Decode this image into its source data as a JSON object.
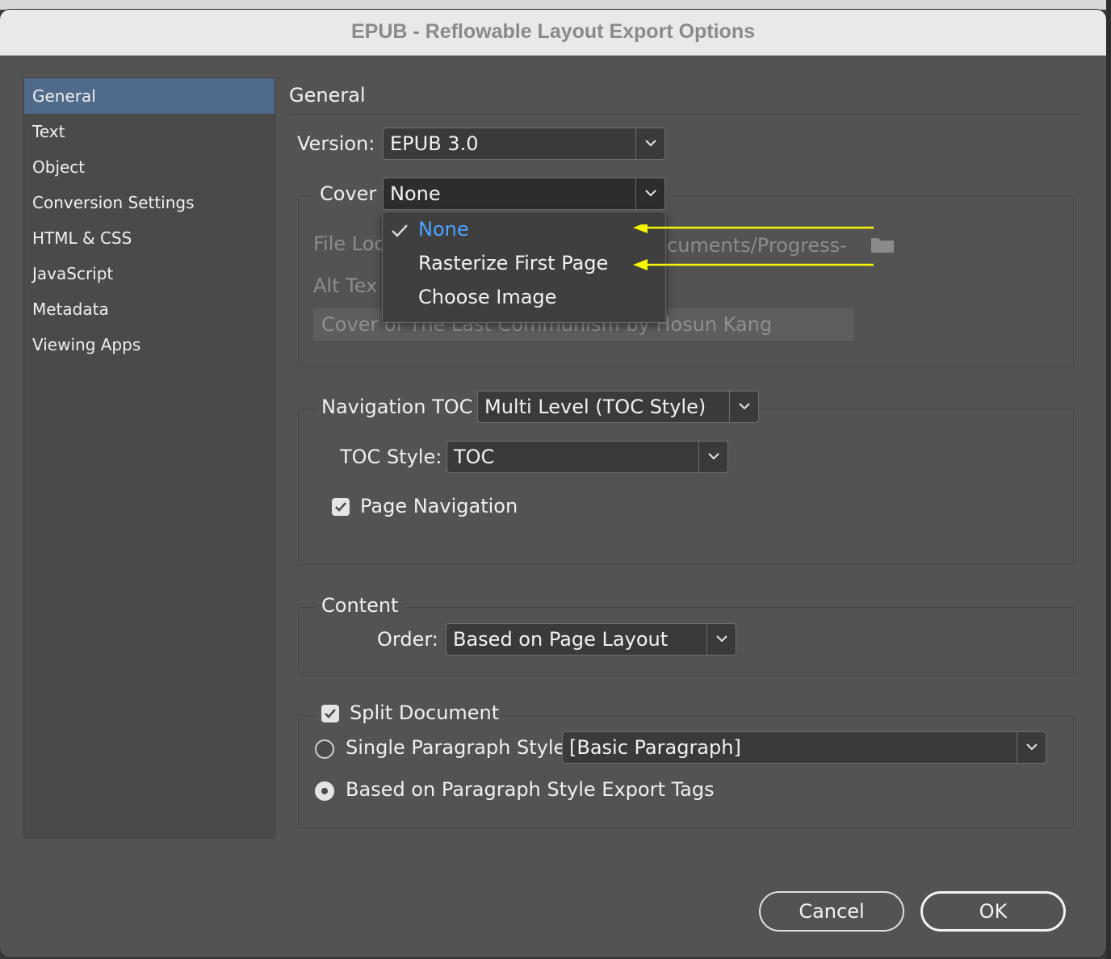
{
  "window": {
    "title": "EPUB - Reflowable Layout Export Options"
  },
  "sidebar": {
    "items": [
      {
        "label": "General",
        "selected": true
      },
      {
        "label": "Text"
      },
      {
        "label": "Object"
      },
      {
        "label": "Conversion Settings"
      },
      {
        "label": "HTML & CSS"
      },
      {
        "label": "JavaScript"
      },
      {
        "label": "Metadata"
      },
      {
        "label": "Viewing Apps"
      }
    ]
  },
  "general": {
    "heading": "General",
    "version": {
      "label": "Version:",
      "value": "EPUB 3.0"
    },
    "cover": {
      "label": "Cover",
      "value": "None",
      "options": [
        "None",
        "Rasterize First Page",
        "Choose Image"
      ],
      "selected_option": "None",
      "file_location_label": "File Loc",
      "file_location_value": "cuments/Progress-",
      "alt_text_label": "Alt Tex",
      "alt_text_value": "Cover of The Last Communism by Hosun Kang"
    },
    "navigation": {
      "label": "Navigation TOC",
      "value": "Multi Level (TOC Style)",
      "toc_style_label": "TOC Style:",
      "toc_style_value": "TOC",
      "page_navigation_label": "Page Navigation",
      "page_navigation_checked": true
    },
    "content": {
      "label": "Content",
      "order_label": "Order:",
      "order_value": "Based on Page Layout"
    },
    "split": {
      "label": "Split Document",
      "checked": true,
      "single_style_label": "Single Paragraph Style",
      "single_style_value": "[Basic Paragraph]",
      "export_tags_label": "Based on Paragraph Style Export Tags",
      "selected_mode": "export_tags"
    }
  },
  "buttons": {
    "cancel": "Cancel",
    "ok": "OK"
  },
  "annotation": {
    "arrow_color": "#f5f500"
  },
  "colors": {
    "selection": "#4f6a8a",
    "menu_highlight": "#4aa3ff"
  }
}
